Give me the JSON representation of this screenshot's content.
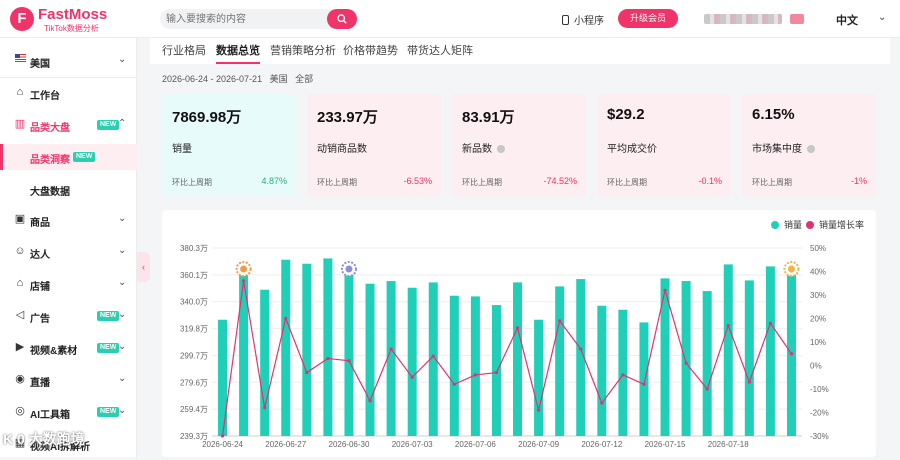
{
  "brand": {
    "name": "FastMoss",
    "sub": "TikTok数据分析",
    "mark": "F"
  },
  "search": {
    "placeholder": "输入要搜索的内容"
  },
  "header": {
    "mini_program": "小程序",
    "upgrade": "升级会员",
    "language": "中文"
  },
  "sidebar": {
    "region": "美国",
    "items": [
      {
        "label": "工作台"
      },
      {
        "label": "品类大盘",
        "badge": "NEW"
      },
      {
        "label": "品类洞察",
        "badge": "NEW"
      },
      {
        "label": "大盘数据"
      },
      {
        "label": "商品"
      },
      {
        "label": "达人"
      },
      {
        "label": "店铺"
      },
      {
        "label": "广告",
        "badge": "NEW"
      },
      {
        "label": "视频&素材",
        "badge": "NEW"
      },
      {
        "label": "直播"
      },
      {
        "label": "AI工具箱",
        "badge": "NEW"
      },
      {
        "label": "视频AI拆解析"
      }
    ]
  },
  "tabs": [
    "行业格局",
    "数据总览",
    "营销策略分析",
    "价格带趋势",
    "带货达人矩阵"
  ],
  "filter": {
    "date_range": "2026-06-24 - 2026-07-21",
    "country": "美国",
    "scope": "全部"
  },
  "cards": [
    {
      "value": "7869.98万",
      "title": "销量",
      "compare": "环比上周期",
      "pct": "4.87%",
      "up": true
    },
    {
      "value": "233.97万",
      "title": "动销商品数",
      "compare": "环比上周期",
      "pct": "-6.53%",
      "up": false
    },
    {
      "value": "83.91万",
      "title": "新品数",
      "compare": "环比上周期",
      "pct": "-74.52%",
      "up": false
    },
    {
      "value": "$29.2",
      "title": "平均成交价",
      "compare": "环比上周期",
      "pct": "-0.1%",
      "up": false
    },
    {
      "value": "6.15%",
      "title": "市场集中度",
      "compare": "环比上周期",
      "pct": "-1%",
      "up": false
    }
  ],
  "colors": {
    "accent": "#f0346a",
    "bar": "#1fcfb8",
    "line": "#e0336f",
    "up": "#22b573",
    "down": "#f0346a"
  },
  "watermark": "K 0 大数跑境",
  "chart_data": {
    "type": "bar",
    "legend": [
      "销量",
      "销量增长率"
    ],
    "legend_position": "top-right",
    "x": [
      "2026-06-24",
      "2026-06-25",
      "2026-06-26",
      "2026-06-27",
      "2026-06-28",
      "2026-06-29",
      "2026-06-30",
      "2026-07-01",
      "2026-07-02",
      "2026-07-03",
      "2026-07-04",
      "2026-07-05",
      "2026-07-06",
      "2026-07-07",
      "2026-07-08",
      "2026-07-09",
      "2026-07-10",
      "2026-07-11",
      "2026-07-12",
      "2026-07-13",
      "2026-07-14",
      "2026-07-15",
      "2026-07-16",
      "2026-07-17",
      "2026-07-18",
      "2026-07-19",
      "2026-07-20",
      "2026-07-21"
    ],
    "x_tick_labels": [
      "2026-06-24",
      "2026-06-27",
      "2026-06-30",
      "2026-07-03",
      "2026-07-06",
      "2026-07-09",
      "2026-07-12",
      "2026-07-15",
      "2026-07-18"
    ],
    "series": [
      {
        "name": "销量",
        "axis": "left",
        "values": [
          3265000,
          3615000,
          3490000,
          3715000,
          3685000,
          3725000,
          3625000,
          3535000,
          3555000,
          3505000,
          3545000,
          3445000,
          3440000,
          3375000,
          3545000,
          3265000,
          3515000,
          3570000,
          3370000,
          3340000,
          3245000,
          3575000,
          3555000,
          3480000,
          3680000,
          3560000,
          3665000,
          3615000
        ]
      },
      {
        "name": "销量增长率",
        "axis": "right",
        "values": [
          -30,
          36,
          -18,
          20,
          -3,
          3,
          2,
          -15,
          7,
          -5,
          4,
          -8,
          -4,
          -3,
          16,
          -19,
          19,
          7,
          -16,
          -4,
          -8,
          32,
          1,
          -10,
          17,
          -7,
          18,
          5
        ]
      }
    ],
    "y_left": {
      "min": 2393000,
      "max": 3803000,
      "ticks": [
        "239.3万",
        "259.4万",
        "279.6万",
        "299.7万",
        "319.8万",
        "340.0万",
        "360.1万",
        "380.3万"
      ]
    },
    "y_right": {
      "min": -30,
      "max": 50,
      "ticks": [
        "-30%",
        "-20%",
        "-10%",
        "0%",
        "10%",
        "20%",
        "30%",
        "40%",
        "50%"
      ]
    },
    "grid": true
  }
}
